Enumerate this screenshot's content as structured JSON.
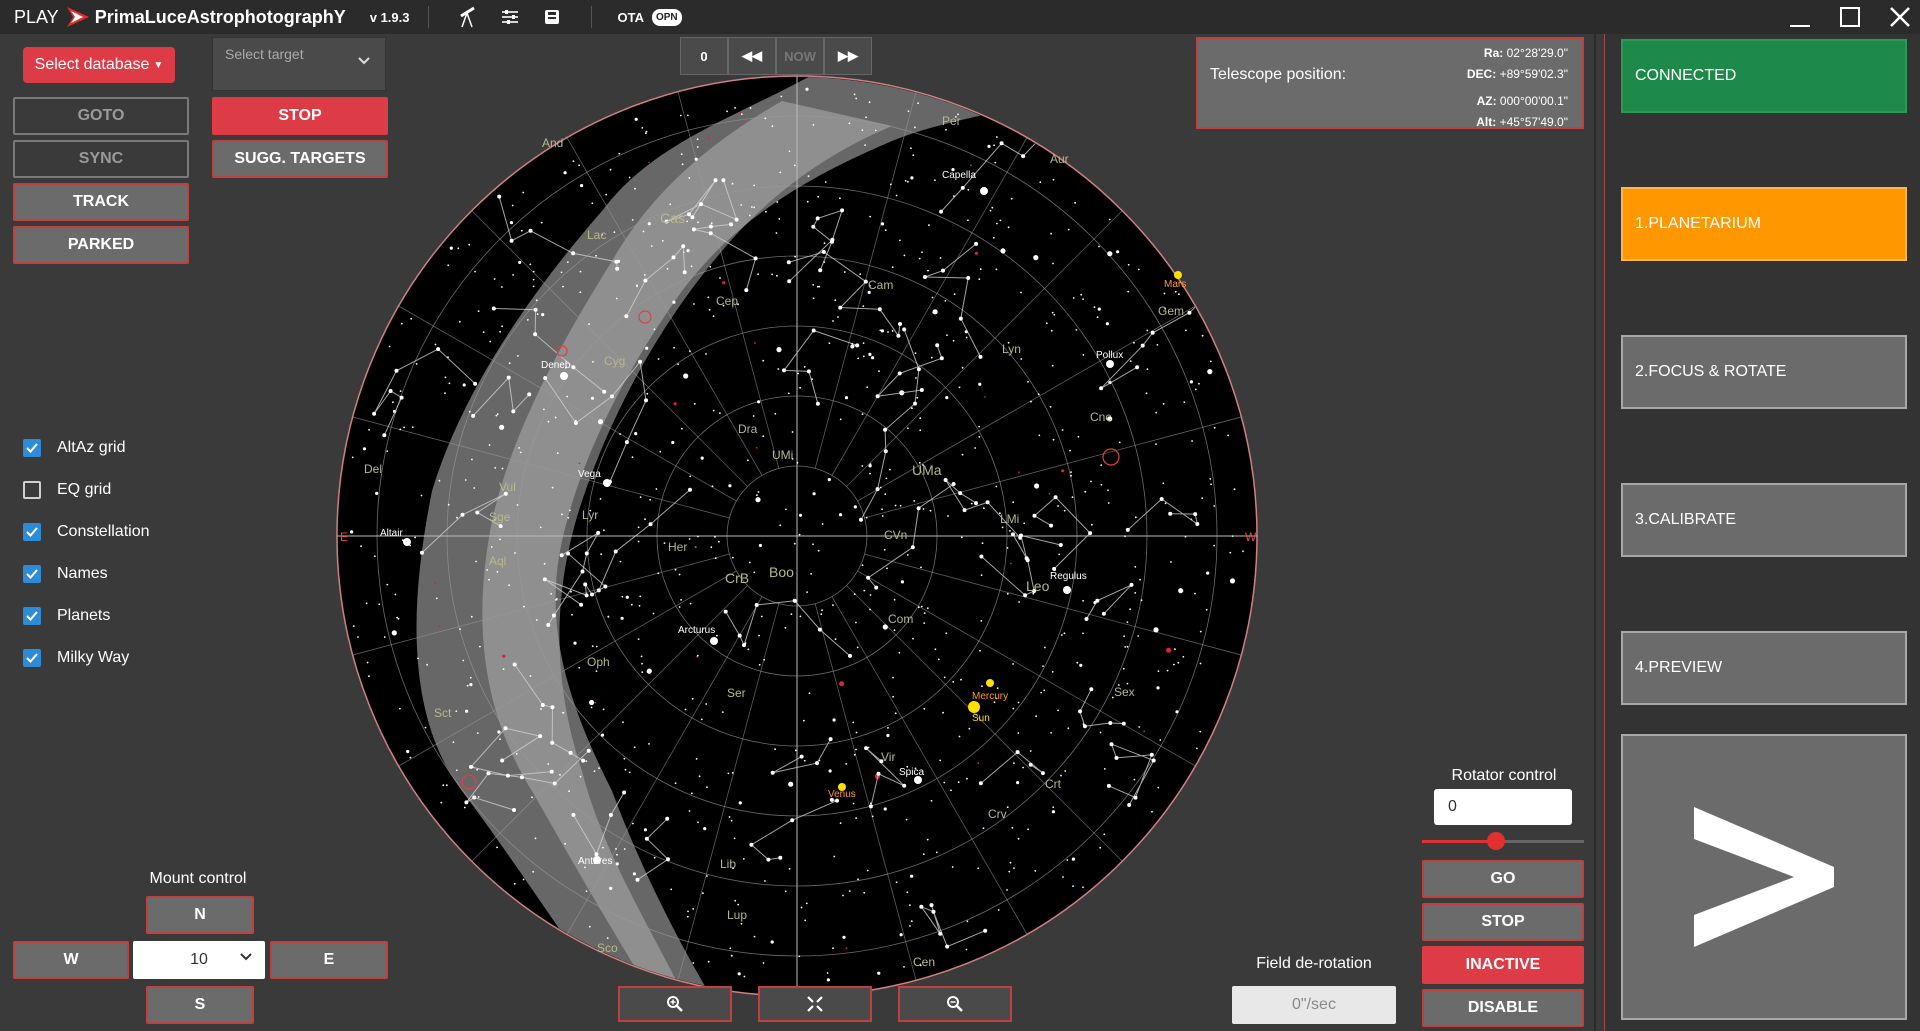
{
  "titlebar": {
    "play": "PLAY",
    "name": "PrimaLuceAstrophotographY",
    "version": "v 1.9.3",
    "ota": "OTA",
    "opn": "OPN",
    "icons": [
      "telescope-icon",
      "sliders-icon",
      "save-icon"
    ]
  },
  "left": {
    "select_database": "Select database",
    "select_target_placeholder": "Select target",
    "goto": "GOTO",
    "sync": "SYNC",
    "track": "TRACK",
    "parked": "PARKED",
    "stop": "STOP",
    "sugg_targets": "SUGG. TARGETS",
    "checks": [
      {
        "label": "AltAz grid",
        "checked": true
      },
      {
        "label": "EQ grid",
        "checked": false
      },
      {
        "label": "Constellation",
        "checked": true
      },
      {
        "label": "Names",
        "checked": true
      },
      {
        "label": "Planets",
        "checked": true
      },
      {
        "label": "Milky Way",
        "checked": true
      }
    ],
    "mount_control": "Mount control",
    "n": "N",
    "s": "S",
    "w": "W",
    "e": "E",
    "step_value": "10"
  },
  "time": {
    "value": "0",
    "now": "NOW"
  },
  "telescope": {
    "label": "Telescope position:",
    "ra_key": "Ra:",
    "ra": "02°28'29.0\"",
    "dec_key": "DEC:",
    "dec": "+89°59'02.3\"",
    "az_key": "AZ:",
    "az": "000°00'00.1\"",
    "alt_key": "Alt:",
    "alt": "+45°57'49.0\""
  },
  "sky": {
    "compass": {
      "e": "E",
      "w": "W"
    },
    "constellations": [
      "And",
      "Per",
      "Aur",
      "Cas",
      "Cep",
      "Cam",
      "Lac",
      "Cyg",
      "Lyn",
      "Gem",
      "Dra",
      "UMi",
      "UMa",
      "Cnc",
      "Del",
      "Lyr",
      "Vul",
      "Sge",
      "Aql",
      "Her",
      "CrB",
      "Boo",
      "CVn",
      "LMi",
      "Leo",
      "Com",
      "Ser",
      "Oph",
      "Sct",
      "Vir",
      "Crt",
      "Crv",
      "Sex",
      "Lib",
      "Lup",
      "Sco",
      "Cen"
    ],
    "stars": [
      "Capella",
      "Deneb",
      "Pollux",
      "Vega",
      "Altair",
      "Regulus",
      "Arcturus",
      "Spica",
      "Antares"
    ],
    "planets": [
      "Mars",
      "Mercury",
      "Sun",
      "Venus"
    ]
  },
  "rotator": {
    "title": "Rotator control",
    "value": "0",
    "level": 0.45,
    "go": "GO",
    "stop": "STOP",
    "inactive": "INACTIVE",
    "disable": "DISABLE"
  },
  "field": {
    "title": "Field de-rotation",
    "rate": "0\"/sec"
  },
  "steps": {
    "connected": "CONNECTED",
    "planetarium": "1.PLANETARIUM",
    "focus": "2.FOCUS & ROTATE",
    "calibrate": "3.CALIBRATE",
    "preview": "4.PREVIEW"
  },
  "colors": {
    "accent_red": "#dd3b45",
    "connected_green": "#1d8a4a",
    "active_orange": "#ff9800",
    "checkbox_blue": "#2d8bd8"
  }
}
